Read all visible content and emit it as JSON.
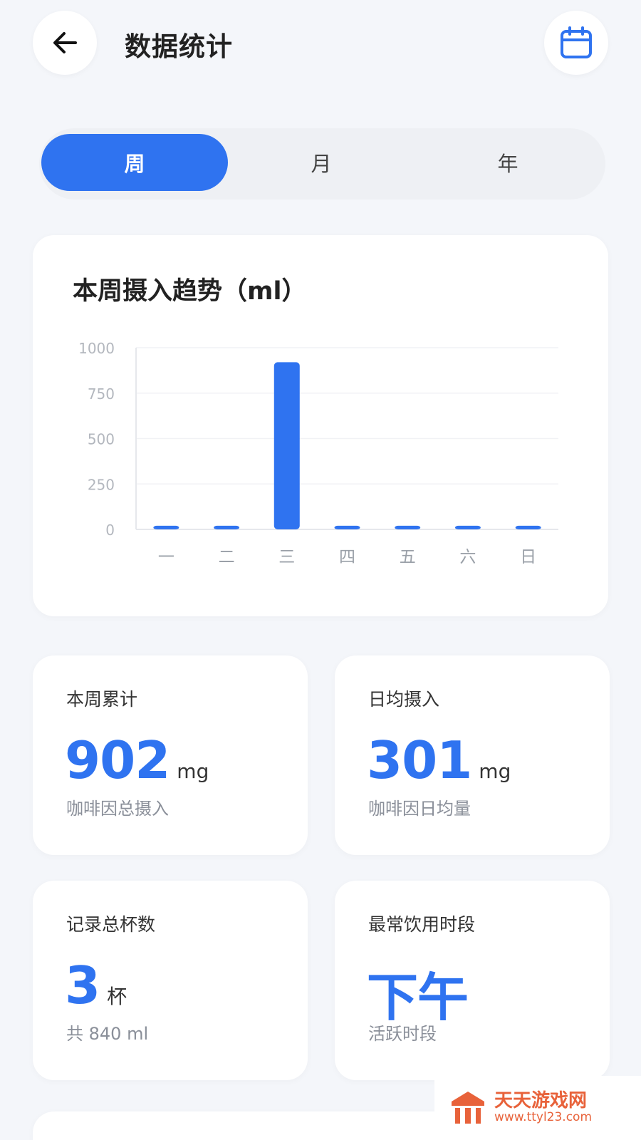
{
  "header": {
    "title": "数据统计",
    "back_icon": "arrow-left-icon",
    "calendar_icon": "calendar-icon"
  },
  "tabs": [
    {
      "label": "周",
      "selected": true
    },
    {
      "label": "月",
      "selected": false
    },
    {
      "label": "年",
      "selected": false
    }
  ],
  "chart_card": {
    "title": "本周摄入趋势（ml）"
  },
  "chart_data": {
    "type": "bar",
    "categories": [
      "一",
      "二",
      "三",
      "四",
      "五",
      "六",
      "日"
    ],
    "values": [
      20,
      20,
      920,
      20,
      20,
      20,
      20
    ],
    "ylim": [
      0,
      1000
    ],
    "yticks": [
      0,
      250,
      500,
      750,
      1000
    ],
    "grid": true,
    "color": "#2f73f0"
  },
  "stats": [
    {
      "label": "本周累计",
      "value": "902",
      "unit": "mg",
      "sub": "咖啡因总摄入"
    },
    {
      "label": "日均摄入",
      "value": "301",
      "unit": "mg",
      "sub": "咖啡因日均量"
    },
    {
      "label": "记录总杯数",
      "value": "3",
      "unit": "杯",
      "sub": "共 840 ml"
    },
    {
      "label": "最常饮用时段",
      "value": "下午",
      "unit": "",
      "sub": "活跃时段"
    }
  ],
  "watermark": {
    "text": "天天游戏网",
    "url": "www.ttyl23.com"
  },
  "colors": {
    "accent": "#2f73f0",
    "background": "#f4f6fa",
    "watermark": "#e8623a"
  }
}
